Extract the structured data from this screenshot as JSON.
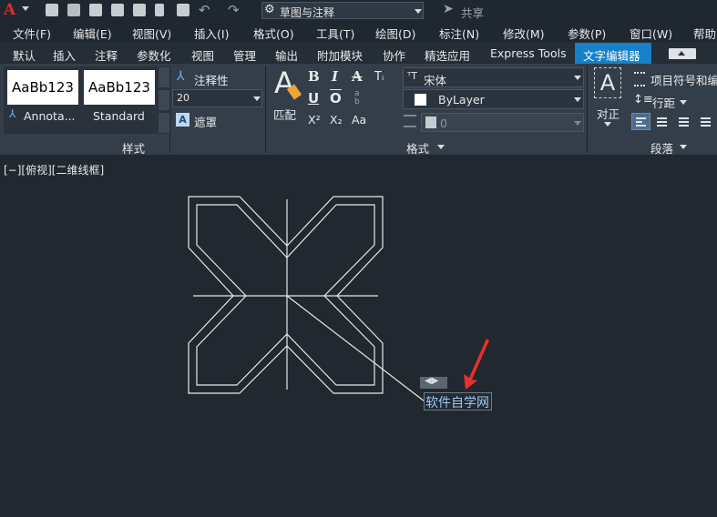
{
  "quick_access": {
    "workspace": "草图与注释",
    "share_label": "共享"
  },
  "menubar": {
    "items": [
      "文件(F)",
      "编辑(E)",
      "视图(V)",
      "插入(I)",
      "格式(O)",
      "工具(T)",
      "绘图(D)",
      "标注(N)",
      "修改(M)",
      "参数(P)",
      "窗口(W)",
      "帮助"
    ]
  },
  "tabs": {
    "items": [
      "默认",
      "插入",
      "注释",
      "参数化",
      "视图",
      "管理",
      "输出",
      "附加模块",
      "协作",
      "精选应用",
      "Express Tools"
    ],
    "active": "文字编辑器"
  },
  "style_panel": {
    "swatch1": "AaBb123",
    "swatch1_name": "Annota...",
    "swatch2": "AaBb123",
    "swatch2_name": "Standard",
    "annotative_label": "注释性",
    "text_height": "20",
    "mask_label": "遮罩",
    "panel_title": "样式"
  },
  "format_panel": {
    "match_label": "匹配",
    "font": "宋体",
    "color": "ByLayer",
    "oblique": "0",
    "panel_title": "格式",
    "bold": "B",
    "italic": "I",
    "underline": "U",
    "overline": "O",
    "superscript": "X²",
    "subscript": "X₂",
    "case": "Aa"
  },
  "paragraph_panel": {
    "justify_label": "对正",
    "bullets_label": "项目符号和编号",
    "line_spacing_label": "行距",
    "panel_title": "段落"
  },
  "canvas": {
    "viewport_label": "[−][俯视][二维线框]",
    "mtext": "软件自学网"
  },
  "colors": {
    "background": "#212830",
    "ribbon": "#343e4b",
    "active_tab": "#1680c8",
    "annotation_arrow": "#e8302a"
  }
}
